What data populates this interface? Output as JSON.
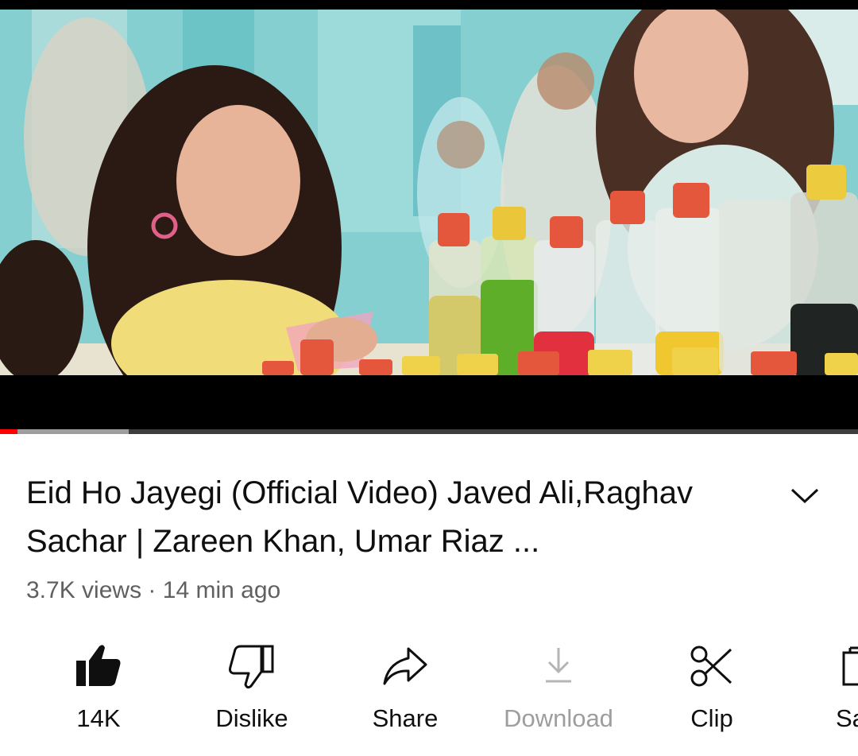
{
  "video": {
    "progress_played": 0.02,
    "progress_buffered": 0.15,
    "accent_color": "#ff0000"
  },
  "info": {
    "title": "Eid Ho Jayegi (Official Video) Javed Ali,Raghav Sachar | Zareen Khan, Umar Riaz ...",
    "views": "3.7K views",
    "separator": "·",
    "time": "14 min ago"
  },
  "actions": [
    {
      "icon": "thumbs-up-filled-icon",
      "label": "14K",
      "enabled": true
    },
    {
      "icon": "thumbs-down-icon",
      "label": "Dislike",
      "enabled": true
    },
    {
      "icon": "share-arrow-icon",
      "label": "Share",
      "enabled": true
    },
    {
      "icon": "download-icon",
      "label": "Download",
      "enabled": false
    },
    {
      "icon": "scissors-icon",
      "label": "Clip",
      "enabled": true
    },
    {
      "icon": "save-icon",
      "label": "Sa",
      "enabled": true
    }
  ]
}
